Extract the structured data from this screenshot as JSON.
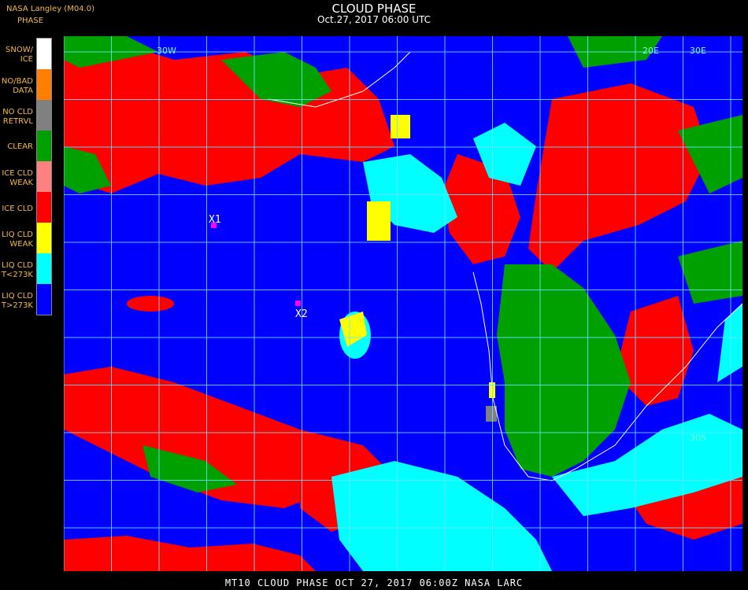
{
  "header": {
    "org": "NASA Langley (M04.0)",
    "product": "PHASE",
    "title": "CLOUD PHASE",
    "subtitle": "Oct.27, 2017 06:00 UTC"
  },
  "legend": [
    {
      "label": "SNOW/\nICE",
      "color": "#ffffff"
    },
    {
      "label": "NO/BAD\nDATA",
      "color": "#ff7f00"
    },
    {
      "label": "NO CLD\nRETRVL",
      "color": "#808080"
    },
    {
      "label": "CLEAR",
      "color": "#00a000"
    },
    {
      "label": "ICE CLD\nWEAK",
      "color": "#ff8080"
    },
    {
      "label": "ICE CLD",
      "color": "#ff0000"
    },
    {
      "label": "LIQ CLD\nWEAK",
      "color": "#ffff00"
    },
    {
      "label": "LIQ CLD\nT<273K",
      "color": "#00ffff"
    },
    {
      "label": "LIQ CLD\nT>273K",
      "color": "#0000ff"
    }
  ],
  "map": {
    "grid_labels": [
      "30W",
      "20E",
      "30E",
      "30S"
    ],
    "markers": [
      "X1",
      "X2"
    ]
  },
  "footer": "MT10  CLOUD PHASE   OCT 27, 2017 06:00Z   NASA LARC"
}
